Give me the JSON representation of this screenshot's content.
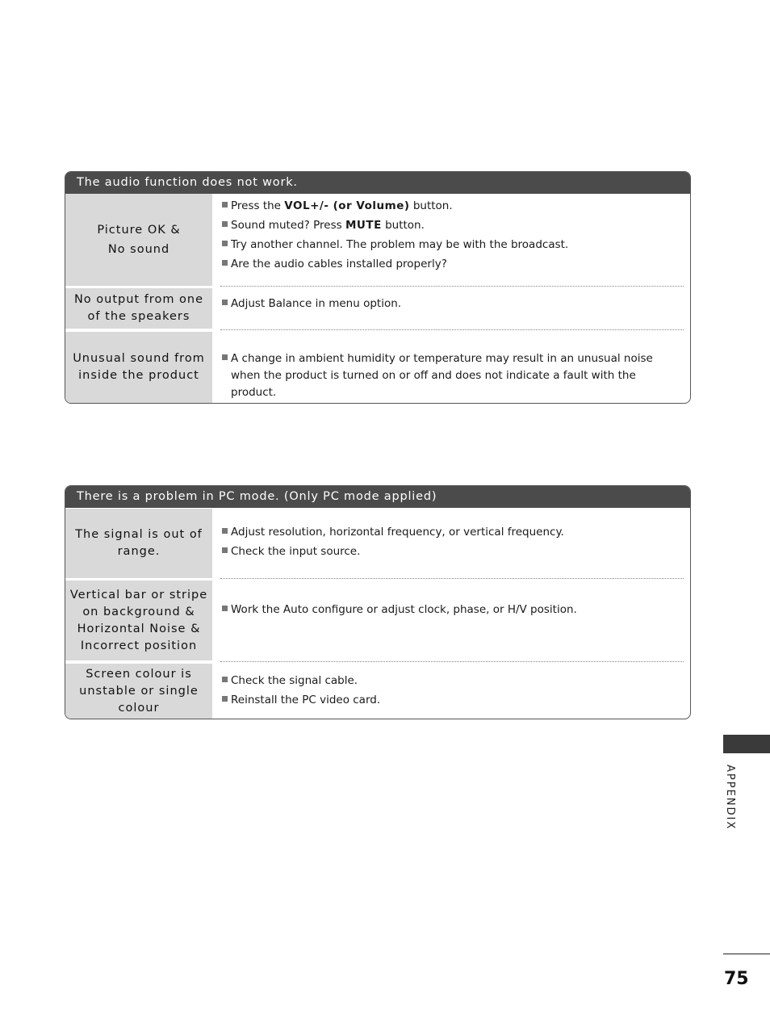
{
  "sections": [
    {
      "title": "The audio function does not work.",
      "rows": [
        {
          "label_lines": [
            "Picture OK &",
            "No sound"
          ],
          "items": [
            {
              "pre": "Press the ",
              "bold": "VOL+/- (or Volume)",
              "post": " button."
            },
            {
              "pre": "Sound muted? Press ",
              "bold": "MUTE",
              "post": " button."
            },
            {
              "pre": "Try another channel. The problem may be with the broadcast.",
              "bold": "",
              "post": ""
            },
            {
              "pre": "Are the audio cables installed properly?",
              "bold": "",
              "post": ""
            }
          ]
        },
        {
          "label_lines": [
            "No output from one",
            "of the speakers"
          ],
          "items": [
            {
              "pre": "Adjust Balance in menu option.",
              "bold": "",
              "post": ""
            }
          ]
        },
        {
          "label_lines": [
            "Unusual sound from",
            "inside the product"
          ],
          "items": [
            {
              "pre": "A change in ambient humidity or temperature may result in an unusual noise when the product is turned on or off and does not indicate a fault with the product.",
              "bold": "",
              "post": ""
            }
          ]
        }
      ]
    },
    {
      "title": "There is a problem in PC mode. (Only PC mode applied)",
      "rows": [
        {
          "label_lines": [
            "The signal is out of",
            "range."
          ],
          "items": [
            {
              "pre": "Adjust resolution, horizontal frequency, or vertical frequency.",
              "bold": "",
              "post": ""
            },
            {
              "pre": "Check the input source.",
              "bold": "",
              "post": ""
            }
          ]
        },
        {
          "label_lines": [
            "Vertical bar or stripe",
            "on background &",
            "Horizontal Noise &",
            "Incorrect position"
          ],
          "items": [
            {
              "pre": "Work the Auto configure or adjust clock, phase, or H/V position.",
              "bold": "",
              "post": ""
            }
          ]
        },
        {
          "label_lines": [
            "Screen colour is",
            "unstable or single",
            "colour"
          ],
          "items": [
            {
              "pre": "Check the signal cable.",
              "bold": "",
              "post": ""
            },
            {
              "pre": "Reinstall the PC video card.",
              "bold": "",
              "post": ""
            }
          ]
        }
      ]
    }
  ],
  "side_label": "APPENDIX",
  "page_number": "75"
}
